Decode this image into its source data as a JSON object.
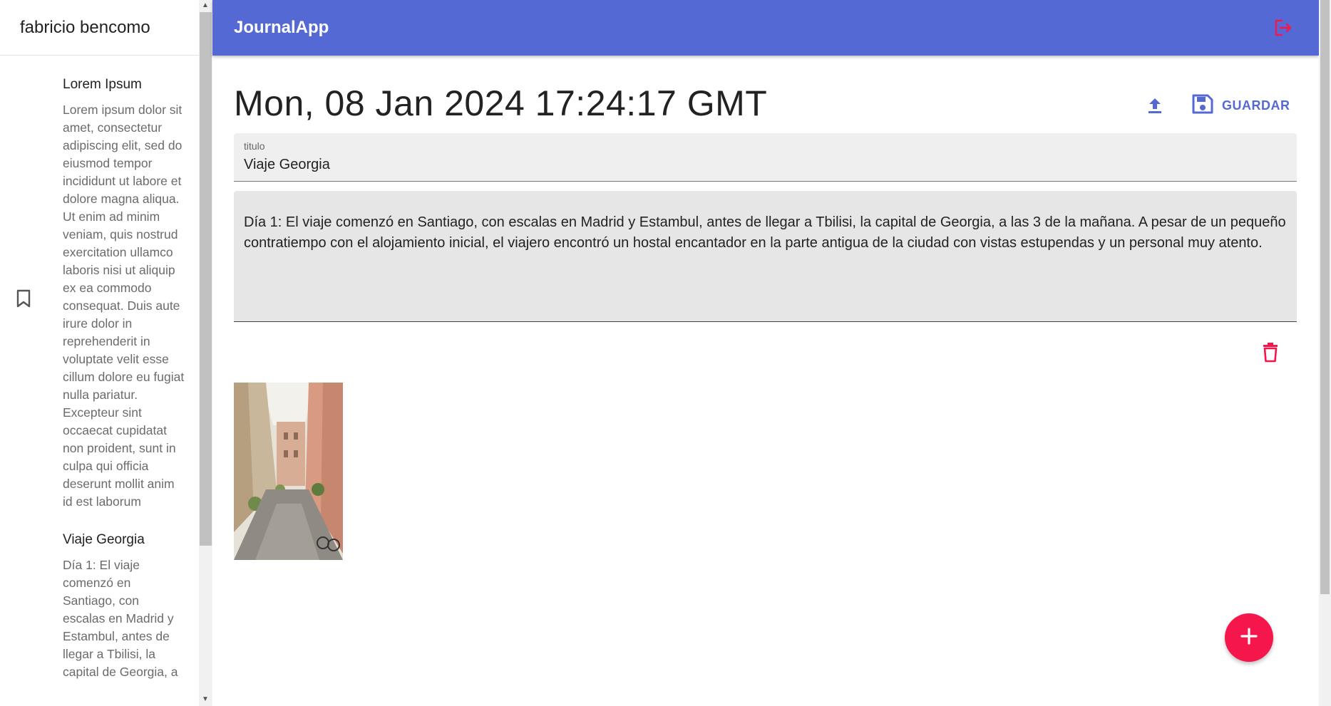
{
  "sidebar": {
    "username": "fabricio bencomo",
    "entries": [
      {
        "title": "Lorem Ipsum",
        "body": "Lorem ipsum dolor sit amet, consectetur adipiscing elit, sed do eiusmod tempor incididunt ut labore et dolore magna aliqua. Ut enim ad minim veniam, quis nostrud exercitation ullamco laboris nisi ut aliquip ex ea commodo consequat. Duis aute irure dolor in reprehenderit in voluptate velit esse cillum dolore eu fugiat nulla pariatur. Excepteur sint occaecat cupidatat non proident, sunt in culpa qui officia deserunt mollit anim id est laborum"
      },
      {
        "title": "Viaje Georgia",
        "body": "Día 1: El viaje comenzó en Santiago, con escalas en Madrid y Estambul, antes de llegar a Tbilisi, la capital de Georgia, a"
      }
    ]
  },
  "appbar": {
    "brand": "JournalApp"
  },
  "note": {
    "date": "Mon, 08 Jan 2024 17:24:17 GMT",
    "save_label": "GUARDAR",
    "title_label": "titulo",
    "title_value": "Viaje Georgia",
    "body_value": "Día 1: El viaje comenzó en Santiago, con escalas en Madrid y Estambul, antes de llegar a Tbilisi, la capital de Georgia, a las 3 de la mañana. A pesar de un pequeño contratiempo con el alojamiento inicial, el viajero encontró un hostal encantador en la parte antigua de la ciudad con vistas estupendas y un personal muy atento."
  },
  "colors": {
    "primary": "#5469d4",
    "accent": "#f5174b"
  },
  "icons": {
    "sidebar_entry": "bookmark-icon",
    "logout": "logout-icon",
    "upload": "upload-icon",
    "save": "save-icon",
    "delete": "trash-icon",
    "fab": "plus-icon"
  }
}
